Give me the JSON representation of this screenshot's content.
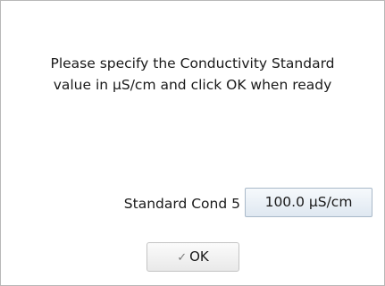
{
  "dialog": {
    "message_line1": "Please specify the Conductivity Standard",
    "message_line2": "value in µS/cm and click OK when ready",
    "field_label": "Standard Cond 5",
    "field_value": "100.0 µS/cm",
    "ok_label": "OK",
    "ok_icon": "✓"
  }
}
